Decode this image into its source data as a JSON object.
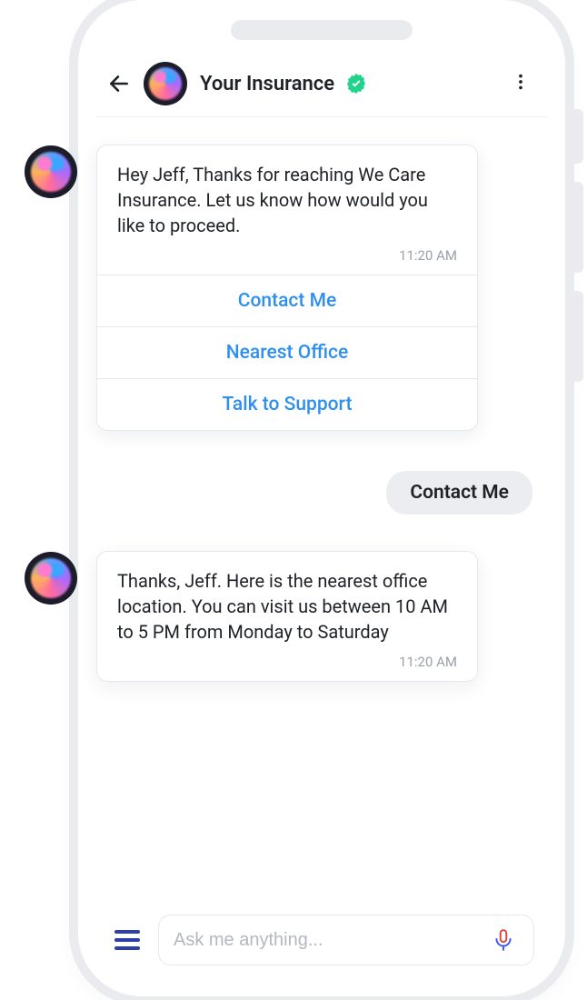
{
  "header": {
    "title": "Your Insurance"
  },
  "messages": {
    "greet": {
      "text": "Hey Jeff, Thanks for reaching We Care Insurance. Let us know how would you like to proceed.",
      "time": "11:20 AM",
      "options": [
        "Contact Me",
        "Nearest Office",
        "Talk to Support"
      ]
    },
    "user_reply": "Contact Me",
    "followup": {
      "text": "Thanks, Jeff. Here is the nearest office location. You can visit us between 10 AM to 5 PM from Monday to Saturday",
      "time": "11:20 AM"
    }
  },
  "composer": {
    "placeholder": "Ask me anything..."
  },
  "colors": {
    "link": "#2f8fef",
    "text": "#1e2126",
    "muted": "#9aa0a8",
    "chip": "#ebedf1",
    "verify": "#1fd38a"
  }
}
